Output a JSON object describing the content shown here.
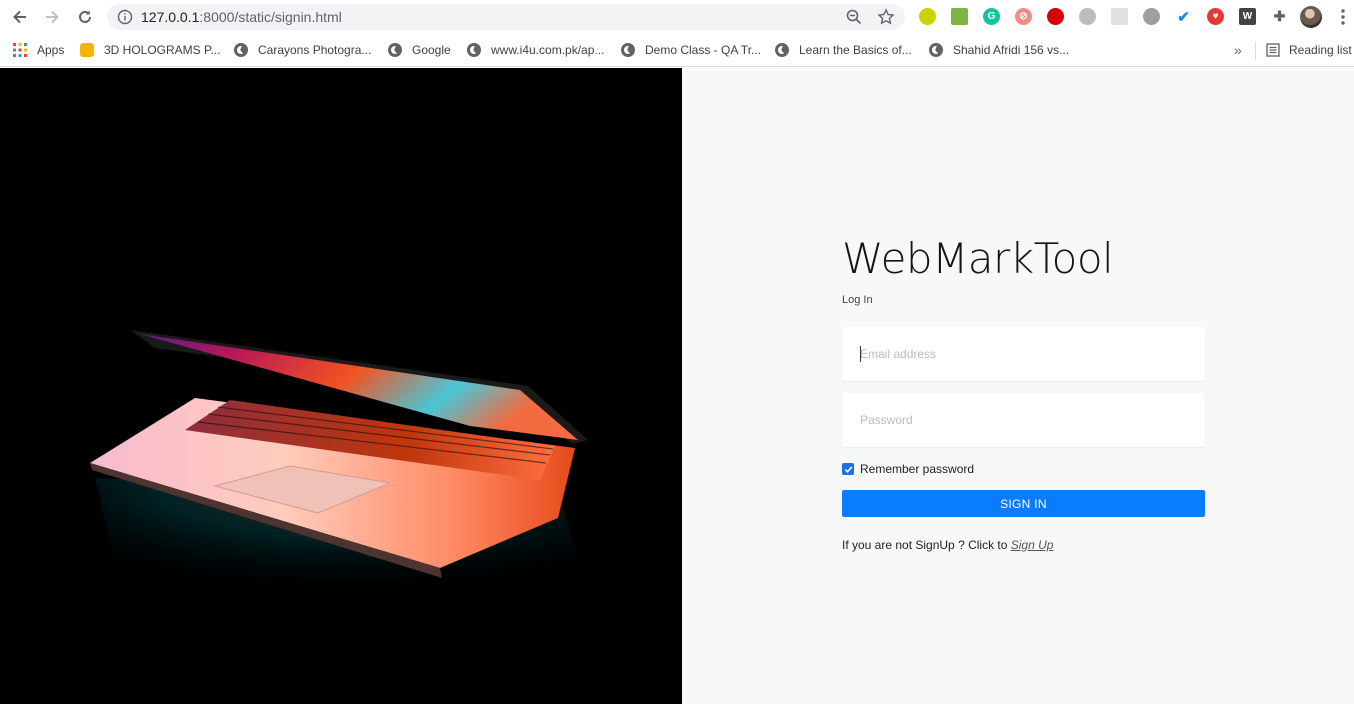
{
  "browser": {
    "url_host": "127.0.0.1",
    "url_path": ":8000/static/signin.html",
    "bookmarks": [
      {
        "label": "Apps"
      },
      {
        "label": "3D HOLOGRAMS P..."
      },
      {
        "label": "Carayons Photogra..."
      },
      {
        "label": "Google"
      },
      {
        "label": "www.i4u.com.pk/ap..."
      },
      {
        "label": "Demo Class - QA Tr..."
      },
      {
        "label": "Learn the Basics of..."
      },
      {
        "label": "Shahid Afridi 156 vs..."
      }
    ],
    "overflow_label": "»",
    "reading_list_label": "Reading list",
    "extensions": [
      "extension-lime-icon",
      "extension-inbox-icon",
      "grammarly-icon",
      "extension-blocked-icon",
      "extension-red-hand-icon",
      "extension-grey-icon",
      "extension-qr-icon",
      "extension-leaf-icon",
      "extension-blue-check-icon",
      "extension-heart-icon",
      "extension-w-icon",
      "puzzle-icon"
    ],
    "colors": {
      "accent": "#1a73e8",
      "omnibox": "#f1f3f4"
    }
  },
  "login": {
    "brand": "WebMarkTool",
    "subtitle": "Log In",
    "email_placeholder": "Email address",
    "password_placeholder": "Password",
    "remember_label": "Remember password",
    "remember_checked": true,
    "signin_label": "SIGN IN",
    "signup_prompt": "If you are not SignUp ? Click to ",
    "signup_link": "Sign Up",
    "colors": {
      "button": "#0a7cff",
      "panel": "#f7f8fa",
      "hero": "#000000"
    }
  },
  "hero_image": {
    "subject": "laptop-glowing-keyboard"
  }
}
